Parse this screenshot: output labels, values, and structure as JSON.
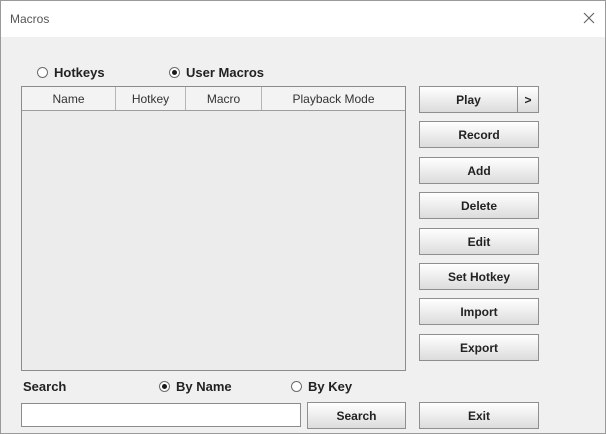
{
  "window": {
    "title": "Macros"
  },
  "mode": {
    "hotkeys_label": "Hotkeys",
    "user_macros_label": "User Macros",
    "selected": "user_macros"
  },
  "table": {
    "columns": [
      "Name",
      "Hotkey",
      "Macro",
      "Playback Mode"
    ]
  },
  "buttons": {
    "play": "Play",
    "play_more": ">",
    "record": "Record",
    "add": "Add",
    "delete": "Delete",
    "edit": "Edit",
    "set_hotkey": "Set Hotkey",
    "import": "Import",
    "export": "Export",
    "search": "Search",
    "exit": "Exit"
  },
  "search": {
    "label": "Search",
    "by_name_label": "By Name",
    "by_key_label": "By Key",
    "selected": "by_name",
    "value": ""
  },
  "icons": {
    "close": "close-icon"
  }
}
